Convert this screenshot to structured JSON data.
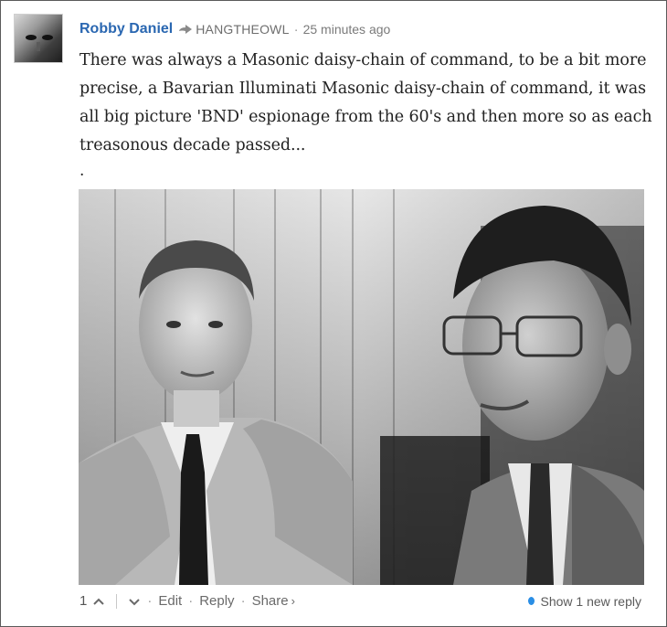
{
  "comment": {
    "author": "Robby Daniel",
    "reply_to": "HANGTHEOWL",
    "timestamp": "25 minutes ago",
    "separator": "·",
    "text": "There was always a Masonic daisy-chain of command, to be a bit more precise, a Bavarian Illuminati Masonic daisy-chain of command, it was all big picture 'BND' espionage from the 60's and then more so as each treasonous decade passed...",
    "trailing_dot": ".",
    "attached_image_icon": "photo"
  },
  "actions": {
    "vote_count": "1",
    "upvote_icon": "chevron-up-icon",
    "downvote_icon": "chevron-down-icon",
    "edit_label": "Edit",
    "reply_label": "Reply",
    "share_label": "Share",
    "share_caret": "›",
    "new_reply_label": "Show 1 new reply"
  },
  "colors": {
    "author_link": "#2a67b1",
    "new_reply_dot": "#2a8ee5"
  }
}
